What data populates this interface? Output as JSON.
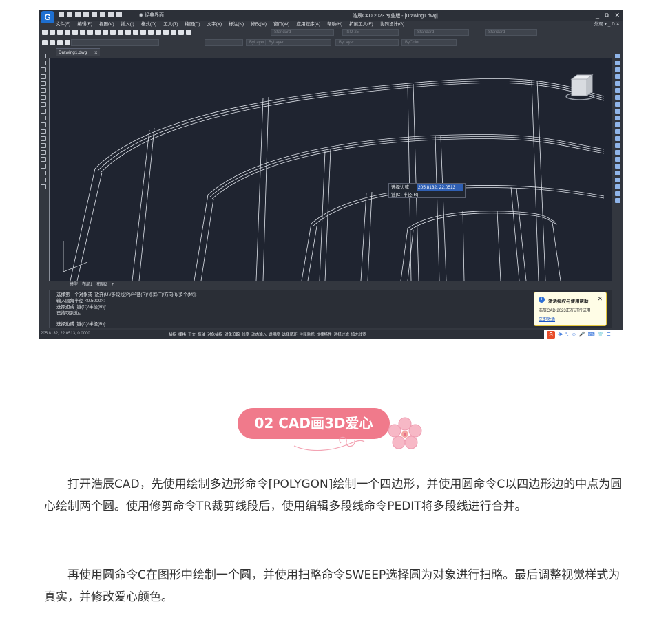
{
  "cad": {
    "title": "浩辰CAD 2023 专业版 - [Drawing1.dwg]",
    "quick_access_dropdown": "◉ 经典界面",
    "window_controls": [
      "_",
      "⧉",
      "✕"
    ],
    "menu": [
      "文件(F)",
      "编辑(E)",
      "视图(V)",
      "插入(I)",
      "格式(O)",
      "工具(T)",
      "绘图(D)",
      "文字(X)",
      "标注(N)",
      "修改(M)",
      "窗口(W)",
      "应用程序(A)",
      "帮助(H)",
      "扩展工具(E)",
      "协同设计(G)"
    ],
    "menu_right": "外观 ▾  _  ⧉  ✕",
    "combos": [
      "Standard",
      "ISO-25",
      "Standard",
      "Standard"
    ],
    "layer_combos": [
      "ByLayer",
      "ByLayer",
      "ByLayer",
      "ByColor"
    ],
    "doc_tab": "Drawing1.dwg",
    "layout_tabs": [
      "模型",
      "布局1",
      "布局2",
      "+"
    ],
    "command_history": [
      "选择第一个对象或 [放弃(U)/多段线(P)/半径(R)/修剪(T)/方向(I)/多个(M)]:",
      "输入圆角半径 <0.5000>:",
      "选择边或 [链(C)/半径(R)]:",
      "已拾取到边。"
    ],
    "command_prompt": "选择边或 [链(C)/半径(R)]:",
    "dynamic_input": {
      "label": "选择边或",
      "value": "205.8132, 22.0513",
      "options": "链(C)  半径(R)"
    },
    "notification": {
      "title": "激活授权与使用帮助",
      "body": "浩辰CAD 2023正在进行试用",
      "link": "立即激活"
    },
    "status_coords": "205.8132, 22.0513, 0.0000",
    "status_items": [
      "捕捉",
      "栅格",
      "正交",
      "极轴",
      "对象捕捉",
      "对象追踪",
      "线宽",
      "动态输入",
      "透明度",
      "选择循环",
      "注释监视",
      "快捷特性",
      "选择过滤",
      "填充线宽"
    ],
    "tray_items": [
      "英",
      "°,",
      "☺",
      "🎤",
      "⌨",
      "👕",
      "☰"
    ]
  },
  "article": {
    "section_title": "02 CAD画3D爱心",
    "paragraph1": "打开浩辰CAD，先使用绘制多边形命令[POLYGON]绘制一个四边形，并使用圆命令C以四边形边的中点为圆心绘制两个圆。使用修剪命令TR裁剪线段后，使用编辑多段线命令PEDIT将多段线进行合并。",
    "paragraph2": "再使用圆命令C在图形中绘制一个圆，并使用扫略命令SWEEP选择圆为对象进行扫略。最后调整视觉样式为真实，并修改爱心颜色。"
  }
}
